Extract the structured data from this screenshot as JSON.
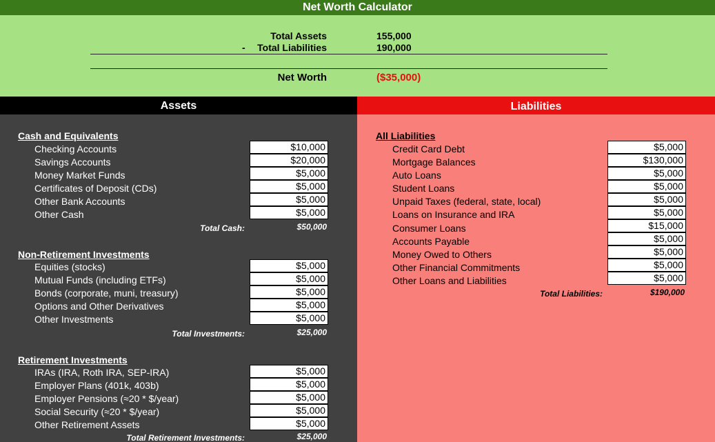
{
  "title": "Net Worth Calculator",
  "summary": {
    "total_assets_label": "Total Assets",
    "total_assets_value": "155,000",
    "minus_sign": "-",
    "total_liabilities_label": "Total Liabilities",
    "total_liabilities_value": "190,000",
    "net_worth_label": "Net Worth",
    "net_worth_value": "($35,000)"
  },
  "colors": {
    "title_bar": "#3b7a1b",
    "summary_bg": "#a6e284",
    "assets_bg": "#414141",
    "liabilities_bg": "#f97f7a",
    "liabilities_header": "#e81010",
    "negative": "#e81010"
  },
  "assets": {
    "header": "Assets",
    "cash": {
      "title": "Cash and Equivalents",
      "rows": [
        {
          "label": "Checking Accounts",
          "value": "$10,000"
        },
        {
          "label": "Savings Accounts",
          "value": "$20,000"
        },
        {
          "label": "Money Market Funds",
          "value": "$5,000"
        },
        {
          "label": "Certificates of Deposit (CDs)",
          "value": "$5,000"
        },
        {
          "label": "Other Bank Accounts",
          "value": "$5,000"
        },
        {
          "label": "Other Cash",
          "value": "$5,000"
        }
      ],
      "total_label": "Total Cash:",
      "total_value": "$50,000"
    },
    "investments": {
      "title": "Non-Retirement Investments",
      "rows": [
        {
          "label": "Equities (stocks)",
          "value": "$5,000"
        },
        {
          "label": "Mutual Funds (including ETFs)",
          "value": "$5,000"
        },
        {
          "label": "Bonds (corporate, muni, treasury)",
          "value": "$5,000"
        },
        {
          "label": "Options and Other Derivatives",
          "value": "$5,000"
        },
        {
          "label": "Other Investments",
          "value": "$5,000"
        }
      ],
      "total_label": "Total Investments:",
      "total_value": "$25,000"
    },
    "retirement": {
      "title": "Retirement Investments",
      "rows": [
        {
          "label": "IRAs (IRA, Roth IRA, SEP-IRA)",
          "value": "$5,000"
        },
        {
          "label": "Employer Plans (401k, 403b)",
          "value": "$5,000"
        },
        {
          "label": "Employer Pensions (≈20 * $/year)",
          "value": "$5,000"
        },
        {
          "label": "Social Security (≈20 * $/year)",
          "value": "$5,000"
        },
        {
          "label": "Other Retirement Assets",
          "value": "$5,000"
        }
      ],
      "total_label": "Total Retirement Investments:",
      "total_value": "$25,000"
    }
  },
  "liabilities": {
    "header": "Liabilities",
    "all": {
      "title": "All Liabilities",
      "rows": [
        {
          "label": "Credit Card Debt",
          "value": "$5,000"
        },
        {
          "label": "Mortgage Balances",
          "value": "$130,000"
        },
        {
          "label": "Auto Loans",
          "value": "$5,000"
        },
        {
          "label": "Student Loans",
          "value": "$5,000"
        },
        {
          "label": "Unpaid Taxes (federal, state, local)",
          "value": "$5,000"
        },
        {
          "label": "Loans on Insurance and IRA",
          "value": "$5,000"
        },
        {
          "label": "Consumer Loans",
          "value": "$15,000"
        },
        {
          "label": "Accounts Payable",
          "value": "$5,000"
        },
        {
          "label": "Money Owed to Others",
          "value": "$5,000"
        },
        {
          "label": "Other Financial Commitments",
          "value": "$5,000"
        },
        {
          "label": "Other Loans and Liabilities",
          "value": "$5,000"
        }
      ],
      "total_label": "Total Liabilities:",
      "total_value": "$190,000"
    }
  }
}
